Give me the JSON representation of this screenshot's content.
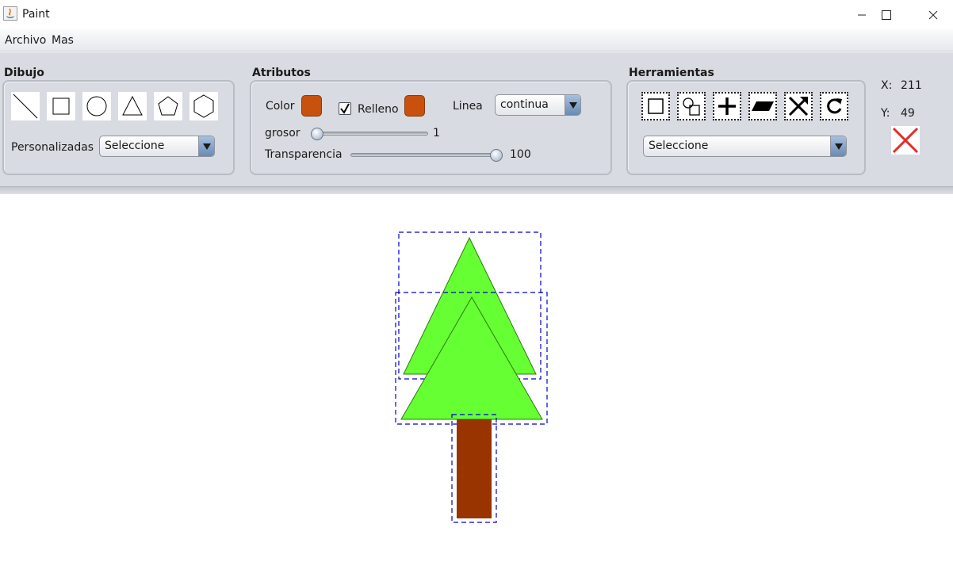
{
  "window": {
    "title": "Paint"
  },
  "menu": {
    "items": [
      "Archivo",
      "Mas"
    ]
  },
  "dibujo": {
    "title": "Dibujo",
    "shapes": [
      "line-icon",
      "square-icon",
      "circle-icon",
      "triangle-icon",
      "pentagon-icon",
      "hexagon-icon"
    ],
    "custom_label": "Personalizadas",
    "custom_value": "Seleccione"
  },
  "atributos": {
    "title": "Atributos",
    "color_label": "Color",
    "color_value": "#c8510e",
    "relleno_label": "Relleno",
    "relleno_checked": true,
    "relleno_color": "#c8510e",
    "linea_label": "Linea",
    "linea_value": "continua",
    "grosor_label": "grosor",
    "grosor_value": "1",
    "transparencia_label": "Transparencia",
    "transparencia_value": "100"
  },
  "herramientas": {
    "title": "Herramientas",
    "tools": [
      "select-icon",
      "group-icon",
      "move-icon",
      "skew-icon",
      "resize-icon",
      "rotate-icon"
    ],
    "dropdown_value": "Seleccione"
  },
  "coords": {
    "x_label": "X:",
    "x_value": "211",
    "y_label": "Y:",
    "y_value": "49"
  },
  "drawing": {
    "tree_green": "#66ff33",
    "trunk_brown": "#993300",
    "selection_color": "#0000cc"
  }
}
